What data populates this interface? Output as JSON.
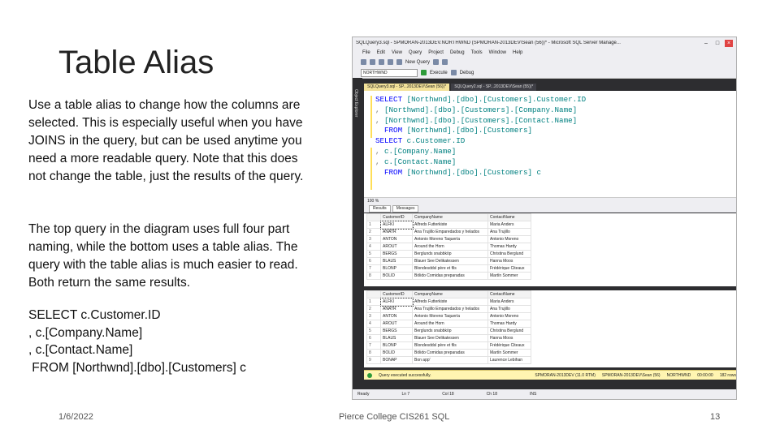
{
  "slide": {
    "title": "Table Alias",
    "paragraph1": "Use a table alias to change how the columns are selected. This is especially useful when you have JOINS in the query, but can be used anytime you need a more readable query. Note that this does not change the table, just the results of the query.",
    "paragraph2": "The top query in the diagram uses full four part naming, while the bottom uses a table alias. The query with the table alias is much easier to read.  Both return the same results.",
    "code_lines": [
      "SELECT c.Customer.ID",
      ", c.[Company.Name]",
      ", c.[Contact.Name]",
      " FROM [Northwnd].[dbo].[Customers] c"
    ]
  },
  "footer": {
    "date": "1/6/2022",
    "center": "Pierce College CIS261 SQL",
    "page_number": "13"
  },
  "ssms": {
    "window_title": "SQLQuery3.sql - SPMORAN-2013DEV.NORTHWND (SPMORAN-2013DEV\\Sean (56))* - Microsoft SQL Server Manage...",
    "menu": [
      "File",
      "Edit",
      "View",
      "Query",
      "Project",
      "Debug",
      "Tools",
      "Window",
      "Help"
    ],
    "toolbar": {
      "new_query": "New Query",
      "database": "NORTHWND",
      "execute": "Execute",
      "debug": "Debug"
    },
    "side_panel": "Object Explorer",
    "tabs": [
      "SQLQuery3.sql - SP...2013DEV\\Sean (56))*",
      "SQLQuery2.sql - SP...2013DEV\\Sean (55))*"
    ],
    "query_lines": [
      {
        "parts": [
          [
            "kw",
            "SELECT "
          ],
          [
            "id",
            "[Northwnd].[dbo].[Customers].Customer.ID"
          ]
        ]
      },
      {
        "parts": [
          [
            "gr",
            ", "
          ],
          [
            "id",
            "[Northwnd].[dbo].[Customers].[Company.Name]"
          ]
        ]
      },
      {
        "parts": [
          [
            "gr",
            ", "
          ],
          [
            "id",
            "[Northwnd].[dbo].[Customers].[Contact.Name]"
          ]
        ]
      },
      {
        "parts": [
          [
            "kw",
            "  FROM "
          ],
          [
            "id",
            "[Northwnd].[dbo].[Customers]"
          ]
        ]
      },
      {
        "parts": [
          [
            "gr",
            ""
          ]
        ]
      },
      {
        "parts": [
          [
            "kw",
            "SELECT "
          ],
          [
            "id",
            "c.Customer.ID"
          ]
        ]
      },
      {
        "parts": [
          [
            "gr",
            ", "
          ],
          [
            "id",
            "c.[Company.Name]"
          ]
        ]
      },
      {
        "parts": [
          [
            "gr",
            ", "
          ],
          [
            "id",
            "c.[Contact.Name]"
          ]
        ]
      },
      {
        "parts": [
          [
            "kw",
            "  FROM "
          ],
          [
            "id",
            "[Northwnd].[dbo].[Customers] c"
          ]
        ]
      }
    ],
    "zoom": "100 %",
    "result_tabs": [
      "Results",
      "Messages"
    ],
    "columns": [
      "CustomerID",
      "CompanyName",
      "ContactName"
    ],
    "rows1": [
      [
        "1",
        "ALFKI",
        "Alfreds Futterkiste",
        "Maria Anders"
      ],
      [
        "2",
        "ANATR",
        "Ana Trujillo Emparedados y helados",
        "Ana Trujillo"
      ],
      [
        "3",
        "ANTON",
        "Antonio Moreno Taquería",
        "Antonio Moreno"
      ],
      [
        "4",
        "AROUT",
        "Around the Horn",
        "Thomas Hardy"
      ],
      [
        "5",
        "BERGS",
        "Berglunds snabbköp",
        "Christina Berglund"
      ],
      [
        "6",
        "BLAUS",
        "Blauer See Delikatessen",
        "Hanna Moos"
      ],
      [
        "7",
        "BLONP",
        "Blondesddsl père et fils",
        "Frédérique Citeaux"
      ],
      [
        "8",
        "BOLID",
        "Bólido Comidas preparadas",
        "Martín Sommer"
      ]
    ],
    "rows2": [
      [
        "1",
        "ALFKI",
        "Alfreds Futterkiste",
        "Maria Anders"
      ],
      [
        "2",
        "ANATR",
        "Ana Trujillo Emparedados y helados",
        "Ana Trujillo"
      ],
      [
        "3",
        "ANTON",
        "Antonio Moreno Taquería",
        "Antonio Moreno"
      ],
      [
        "4",
        "AROUT",
        "Around the Horn",
        "Thomas Hardy"
      ],
      [
        "5",
        "BERGS",
        "Berglunds snabbköp",
        "Christina Berglund"
      ],
      [
        "6",
        "BLAUS",
        "Blauer See Delikatessen",
        "Hanna Moos"
      ],
      [
        "7",
        "BLONP",
        "Blondesddsl père et fils",
        "Frédérique Citeaux"
      ],
      [
        "8",
        "BOLID",
        "Bólido Comidas preparadas",
        "Martín Sommer"
      ],
      [
        "9",
        "BONAP",
        "Bon app'",
        "Laurence Lebihan"
      ]
    ],
    "status": {
      "message": "Query executed successfully.",
      "server": "SPMORAN-2013DEV (11.0 RTM)",
      "user": "SPMORAN-2013DEV\\Sean (56)",
      "database": "NORTHWND",
      "time": "00:00:00",
      "rows": "182 rows"
    },
    "readybar": {
      "ready": "Ready",
      "line": "Ln 7",
      "col": "Col 18",
      "ch": "Ch 18",
      "mode": "INS"
    }
  }
}
